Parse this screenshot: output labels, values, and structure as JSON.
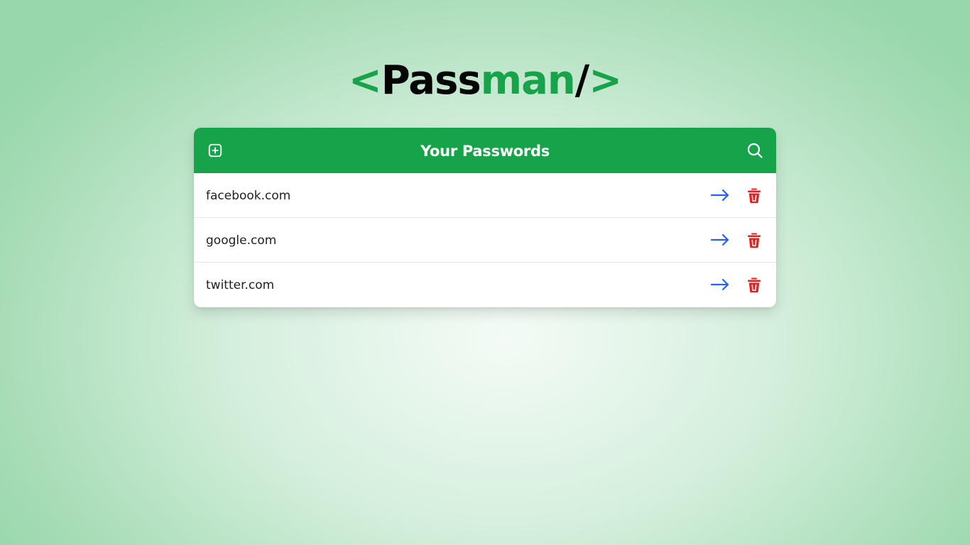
{
  "logo": {
    "open_bracket": "<",
    "part1": "Pass",
    "part2": "man",
    "slash": "/",
    "close_bracket": ">"
  },
  "header": {
    "title": "Your Passwords",
    "add_icon": "plus-square-icon",
    "search_icon": "search-icon"
  },
  "entries": [
    {
      "site": "facebook.com"
    },
    {
      "site": "google.com"
    },
    {
      "site": "twitter.com"
    }
  ],
  "colors": {
    "accent": "#16a34a",
    "open_action": "#2563eb",
    "delete_action": "#dc2626"
  }
}
